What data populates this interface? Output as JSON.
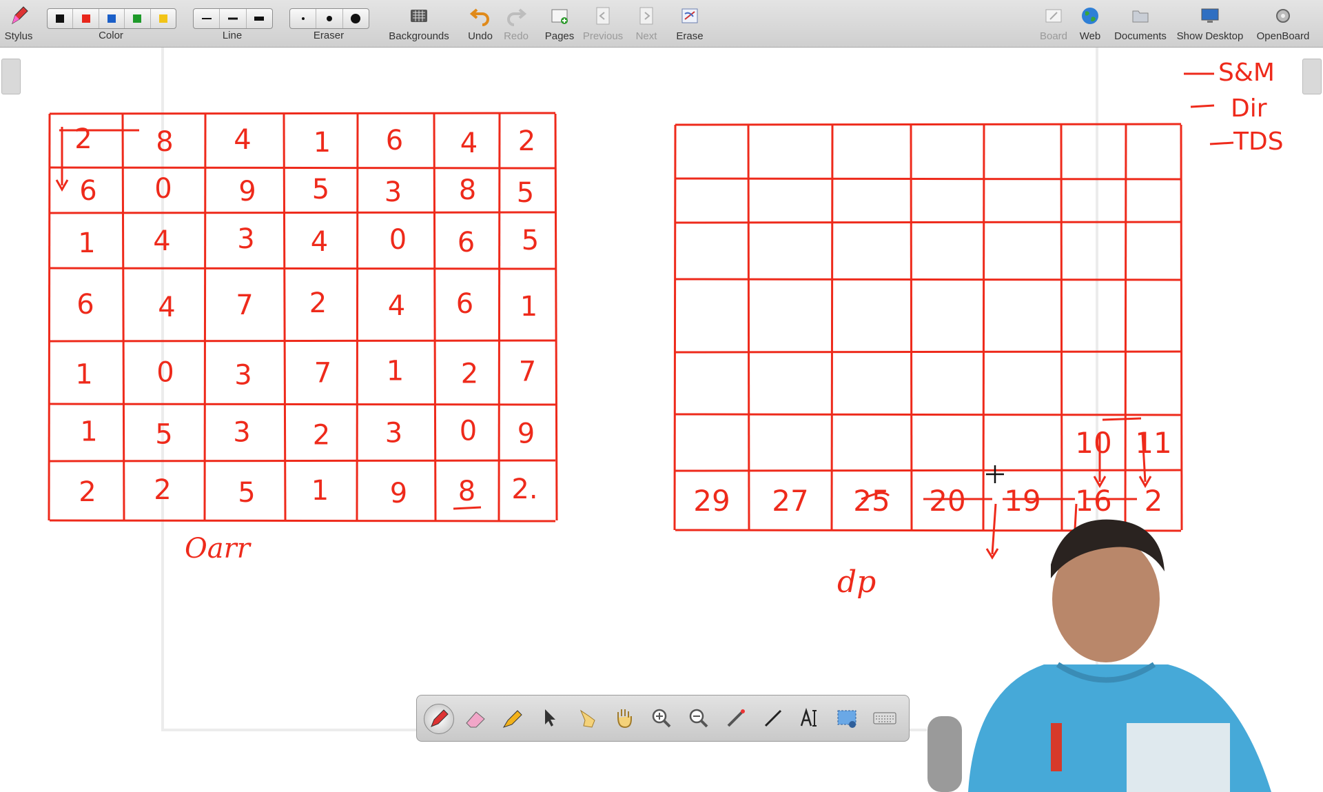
{
  "toolbar": {
    "stylus": "Stylus",
    "color": "Color",
    "line": "Line",
    "eraser": "Eraser",
    "backgrounds": "Backgrounds",
    "undo": "Undo",
    "redo": "Redo",
    "pages": "Pages",
    "previous": "Previous",
    "next": "Next",
    "erase": "Erase",
    "board": "Board",
    "web": "Web",
    "documents": "Documents",
    "show_desktop": "Show Desktop",
    "openboard": "OpenBoard",
    "colors": [
      "#111111",
      "#e8261b",
      "#1b5fc8",
      "#1e9a2a",
      "#f2c418"
    ]
  },
  "board": {
    "ink_color": "#ee2a1b",
    "left_grid": [
      [
        "2",
        "8",
        "4",
        "1",
        "6",
        "4",
        "2"
      ],
      [
        "6",
        "0",
        "9",
        "5",
        "3",
        "8",
        "5"
      ],
      [
        "1",
        "4",
        "3",
        "4",
        "0",
        "6",
        "5"
      ],
      [
        "6",
        "4",
        "7",
        "2",
        "4",
        "6",
        "1"
      ],
      [
        "1",
        "0",
        "3",
        "7",
        "1",
        "2",
        "7"
      ],
      [
        "1",
        "5",
        "3",
        "2",
        "3",
        "0",
        "9"
      ],
      [
        "2",
        "2",
        "5",
        "1",
        "9",
        "8",
        "2."
      ]
    ],
    "left_label": "Oarr",
    "right_grid_row6": [
      "",
      "",
      "",
      "",
      "",
      "10",
      "11"
    ],
    "right_grid_last_row": [
      "29",
      "27",
      "25",
      "20",
      "19",
      "16",
      "2"
    ],
    "right_label": "dp",
    "notes": [
      "S&M",
      "Dir",
      "TDS"
    ]
  },
  "floatbar": {
    "tools": [
      "pen-icon",
      "eraser-icon",
      "marker-icon",
      "select-icon",
      "pointer-hand-icon",
      "hand-icon",
      "zoom-in-icon",
      "zoom-out-icon",
      "laser-icon",
      "line-icon",
      "text-icon",
      "capture-icon",
      "keyboard-icon"
    ]
  }
}
